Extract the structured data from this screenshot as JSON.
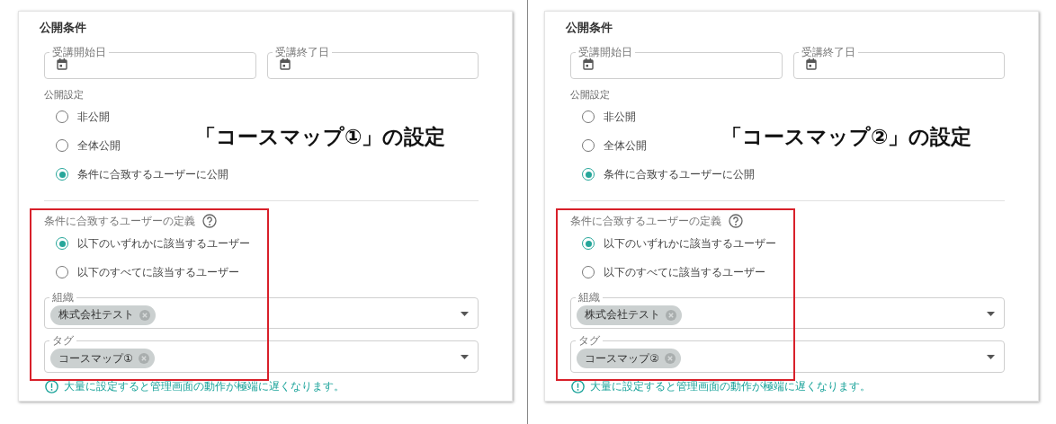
{
  "panels": [
    {
      "caption": "「コースマップ①」の設定",
      "section_title": "公開条件",
      "date_fields": [
        {
          "label": "受講開始日"
        },
        {
          "label": "受講終了日"
        }
      ],
      "visibility_label": "公開設定",
      "visibility_options": [
        {
          "label": "非公開",
          "selected": false
        },
        {
          "label": "全体公開",
          "selected": false
        },
        {
          "label": "条件に合致するユーザーに公開",
          "selected": true
        }
      ],
      "definition_label": "条件に合致するユーザーの定義",
      "match_options": [
        {
          "label": "以下のいずれかに該当するユーザー",
          "selected": true
        },
        {
          "label": "以下のすべてに該当するユーザー",
          "selected": false
        }
      ],
      "select_fields": [
        {
          "label": "組織",
          "chips": [
            "株式会社テスト"
          ]
        },
        {
          "label": "タグ",
          "chips": [
            "コースマップ①"
          ]
        }
      ],
      "warning": "大量に設定すると管理画面の動作が極端に遅くなります。"
    },
    {
      "caption": "「コースマップ②」の設定",
      "section_title": "公開条件",
      "date_fields": [
        {
          "label": "受講開始日"
        },
        {
          "label": "受講終了日"
        }
      ],
      "visibility_label": "公開設定",
      "visibility_options": [
        {
          "label": "非公開",
          "selected": false
        },
        {
          "label": "全体公開",
          "selected": false
        },
        {
          "label": "条件に合致するユーザーに公開",
          "selected": true
        }
      ],
      "definition_label": "条件に合致するユーザーの定義",
      "match_options": [
        {
          "label": "以下のいずれかに該当するユーザー",
          "selected": true
        },
        {
          "label": "以下のすべてに該当するユーザー",
          "selected": false
        }
      ],
      "select_fields": [
        {
          "label": "組織",
          "chips": [
            "株式会社テスト"
          ]
        },
        {
          "label": "タグ",
          "chips": [
            "コースマップ②"
          ]
        }
      ],
      "warning": "大量に設定すると管理画面の動作が極端に遅くなります。"
    }
  ]
}
